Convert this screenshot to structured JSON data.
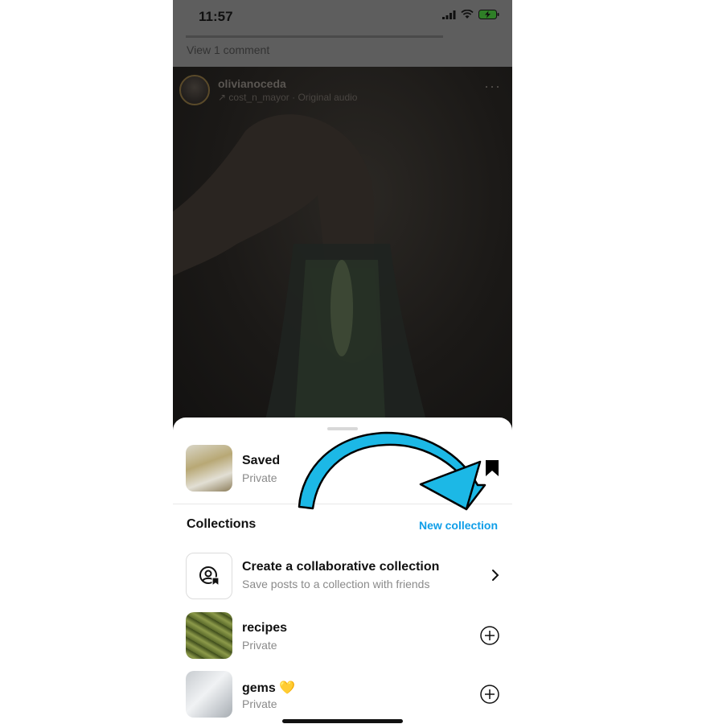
{
  "status_bar": {
    "time": "11:57"
  },
  "previous_post": {
    "view_comments": "View 1 comment"
  },
  "reel": {
    "username": "olivianoceda",
    "audio": "cost_n_mayor · Original audio",
    "more": "···"
  },
  "saved": {
    "title": "Saved",
    "privacy": "Private"
  },
  "collections": {
    "header": "Collections",
    "new_collection_label": "New collection",
    "collaborative": {
      "title": "Create a collaborative collection",
      "subtitle": "Save posts to a collection with friends"
    },
    "items": [
      {
        "title": "recipes",
        "privacy": "Private"
      },
      {
        "title": "gems 💛",
        "privacy": "Private"
      }
    ]
  },
  "colors": {
    "accent": "#0f9ee8",
    "annotation_arrow": "#1cb8e6"
  }
}
